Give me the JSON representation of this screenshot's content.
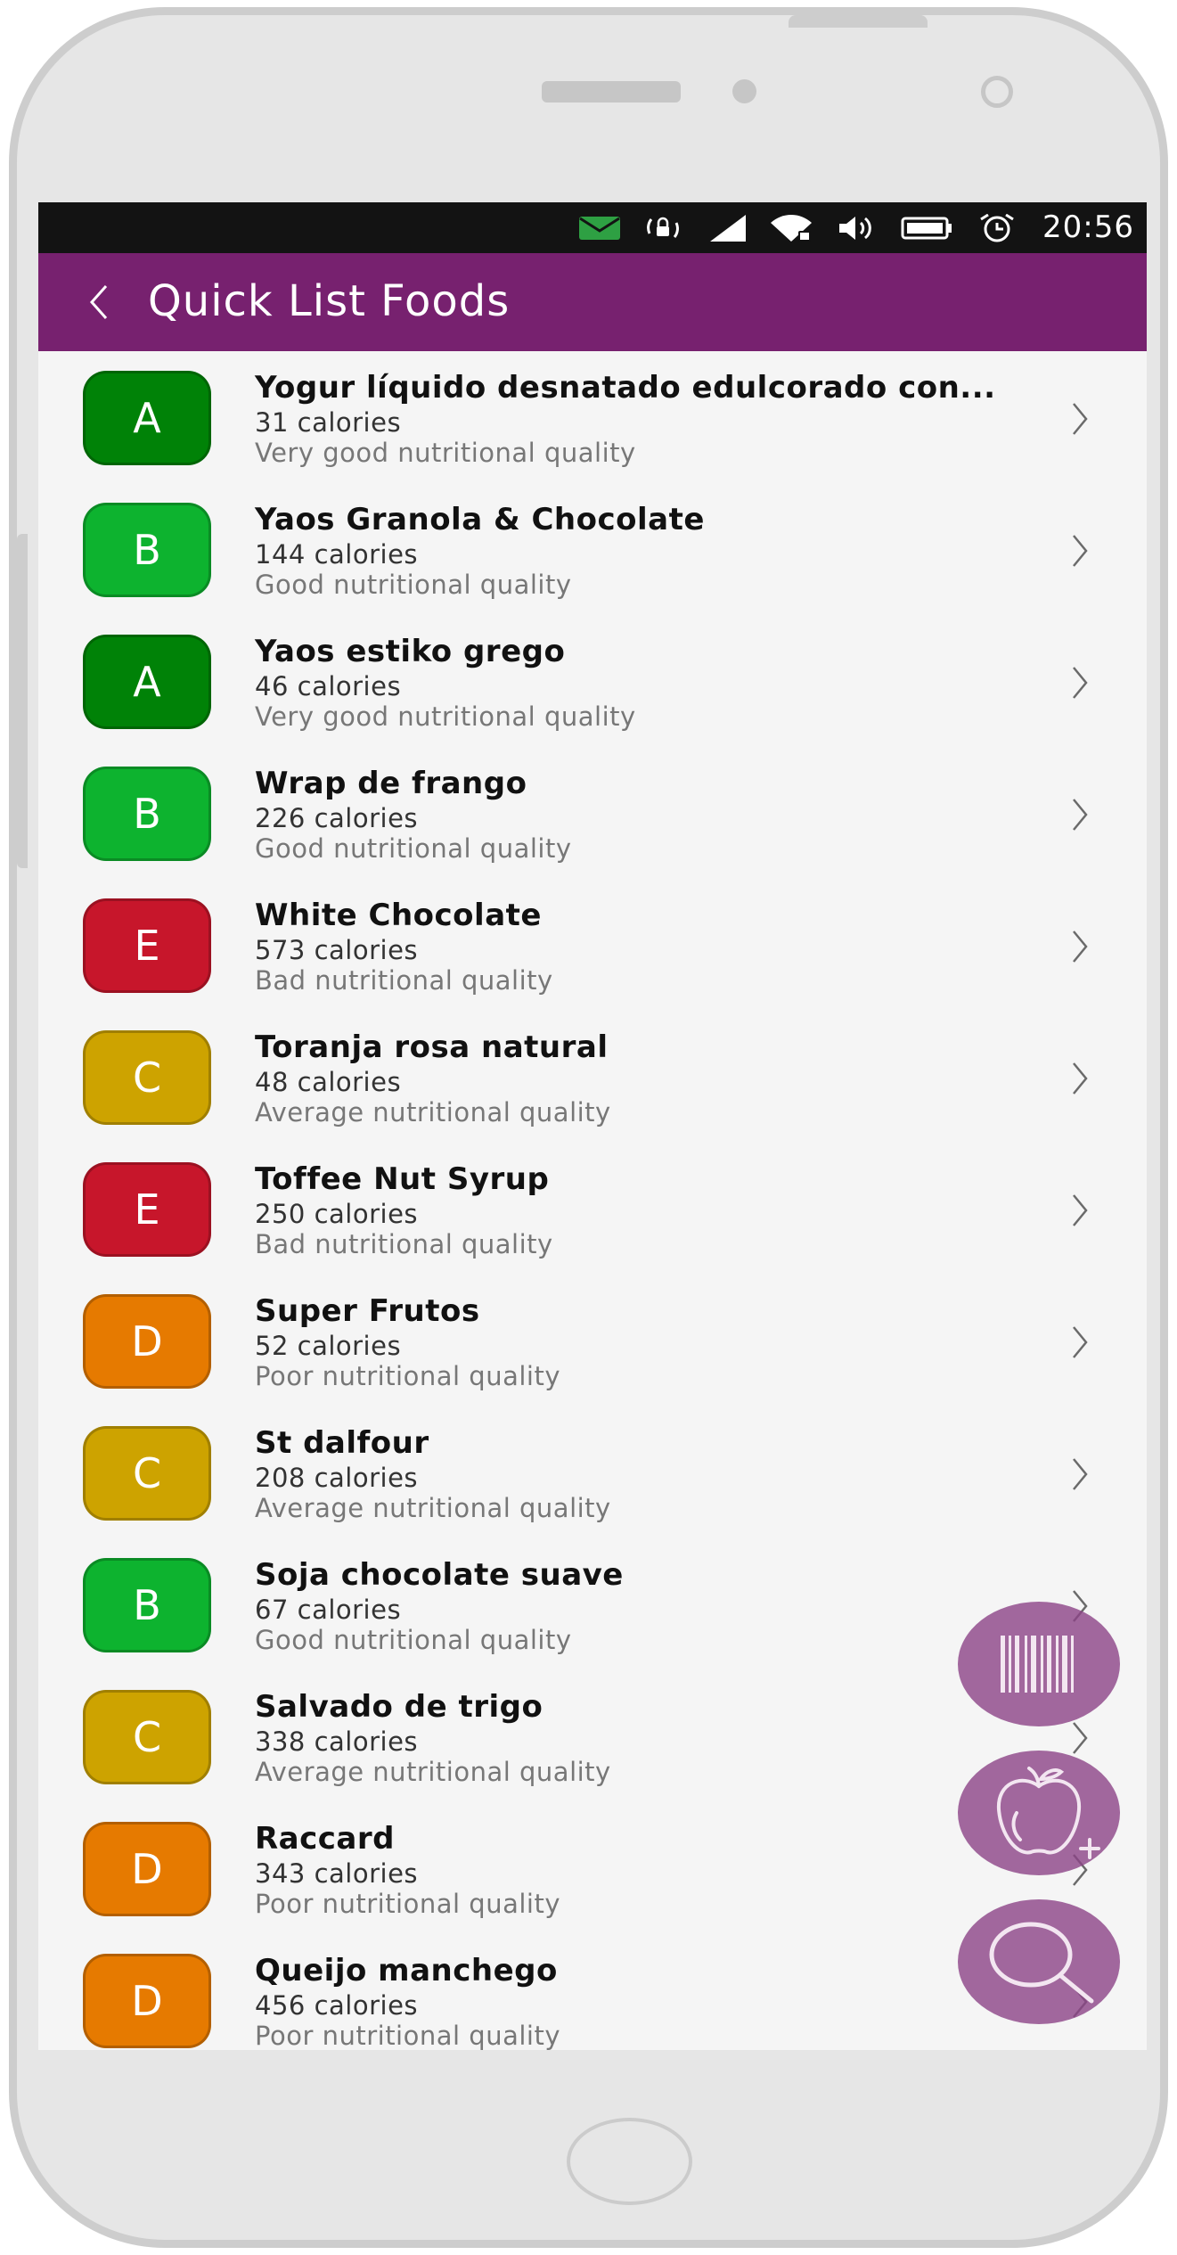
{
  "status_bar": {
    "time": "20:56",
    "icons": [
      "message-icon",
      "rotation-lock-icon",
      "cellular-signal-icon",
      "wifi-icon",
      "volume-icon",
      "battery-icon",
      "alarm-icon"
    ],
    "message_icon_color": "#2ea043"
  },
  "header": {
    "title": "Quick List Foods",
    "background": "#77216f"
  },
  "grade_colors": {
    "A": "#008207",
    "B": "#0db32f",
    "C": "#cda300",
    "D": "#e67a00",
    "E": "#c7162b"
  },
  "items": [
    {
      "grade": "A",
      "name": "Yogur líquido desnatado edulcorado con...",
      "calories": "31 calories",
      "quality": "Very good nutritional quality"
    },
    {
      "grade": "B",
      "name": "Yaos Granola & Chocolate",
      "calories": "144 calories",
      "quality": "Good nutritional quality"
    },
    {
      "grade": "A",
      "name": "Yaos estiko grego",
      "calories": "46 calories",
      "quality": "Very good nutritional quality"
    },
    {
      "grade": "B",
      "name": "Wrap de frango",
      "calories": "226 calories",
      "quality": "Good nutritional quality"
    },
    {
      "grade": "E",
      "name": "White Chocolate",
      "calories": "573 calories",
      "quality": "Bad nutritional quality"
    },
    {
      "grade": "C",
      "name": "Toranja rosa natural",
      "calories": "48 calories",
      "quality": "Average nutritional quality"
    },
    {
      "grade": "E",
      "name": "Toffee Nut Syrup",
      "calories": "250 calories",
      "quality": "Bad nutritional quality"
    },
    {
      "grade": "D",
      "name": "Super Frutos",
      "calories": "52 calories",
      "quality": "Poor nutritional quality"
    },
    {
      "grade": "C",
      "name": "St dalfour",
      "calories": "208 calories",
      "quality": "Average nutritional quality"
    },
    {
      "grade": "B",
      "name": "Soja chocolate suave",
      "calories": "67 calories",
      "quality": "Good nutritional quality"
    },
    {
      "grade": "C",
      "name": "Salvado de trigo",
      "calories": "338 calories",
      "quality": "Average nutritional quality"
    },
    {
      "grade": "D",
      "name": "Raccard",
      "calories": "343 calories",
      "quality": "Poor nutritional quality"
    },
    {
      "grade": "D",
      "name": "Queijo manchego",
      "calories": "456 calories",
      "quality": "Poor nutritional quality"
    }
  ],
  "fab_buttons": [
    {
      "name": "scan-barcode-button",
      "icon": "barcode-icon"
    },
    {
      "name": "add-food-button",
      "icon": "apple-plus-icon"
    },
    {
      "name": "search-button",
      "icon": "search-icon"
    }
  ],
  "fab_color": "#8c4387"
}
